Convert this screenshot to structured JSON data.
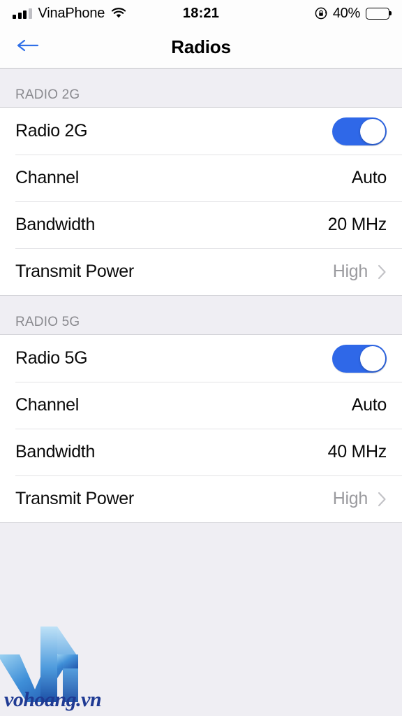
{
  "statusbar": {
    "carrier": "VinaPhone",
    "time": "18:21",
    "battery_percent": "40%",
    "battery_level": 40,
    "signal_bars_filled": 3,
    "signal_bars_total": 4,
    "icons": [
      "signal-bars-icon",
      "wifi-icon",
      "rotation-lock-icon",
      "battery-icon"
    ]
  },
  "navbar": {
    "title": "Radios",
    "back_icon": "back-arrow-icon",
    "accent_color": "#2F6FE8"
  },
  "sections": [
    {
      "header": "RADIO 2G",
      "rows": [
        {
          "label": "Radio 2G",
          "type": "toggle",
          "value": "",
          "on": true
        },
        {
          "label": "Channel",
          "type": "value",
          "value": "Auto",
          "muted": false,
          "chevron": false
        },
        {
          "label": "Bandwidth",
          "type": "value",
          "value": "20 MHz",
          "muted": false,
          "chevron": false
        },
        {
          "label": "Transmit Power",
          "type": "value",
          "value": "High",
          "muted": true,
          "chevron": true
        }
      ]
    },
    {
      "header": "RADIO 5G",
      "rows": [
        {
          "label": "Radio 5G",
          "type": "toggle",
          "value": "",
          "on": true
        },
        {
          "label": "Channel",
          "type": "value",
          "value": "Auto",
          "muted": false,
          "chevron": false
        },
        {
          "label": "Bandwidth",
          "type": "value",
          "value": "40 MHz",
          "muted": false,
          "chevron": false
        },
        {
          "label": "Transmit Power",
          "type": "value",
          "value": "High",
          "muted": true,
          "chevron": true
        }
      ]
    }
  ],
  "watermark": {
    "text": "vohoang.vn",
    "logo": "vh-monogram-logo"
  },
  "colors": {
    "accent": "#2F68E8",
    "group_bg": "#FFFFFF",
    "page_bg": "#EFEEF3",
    "muted_text": "#9B9B9F",
    "header_text": "#8A8A8F"
  }
}
